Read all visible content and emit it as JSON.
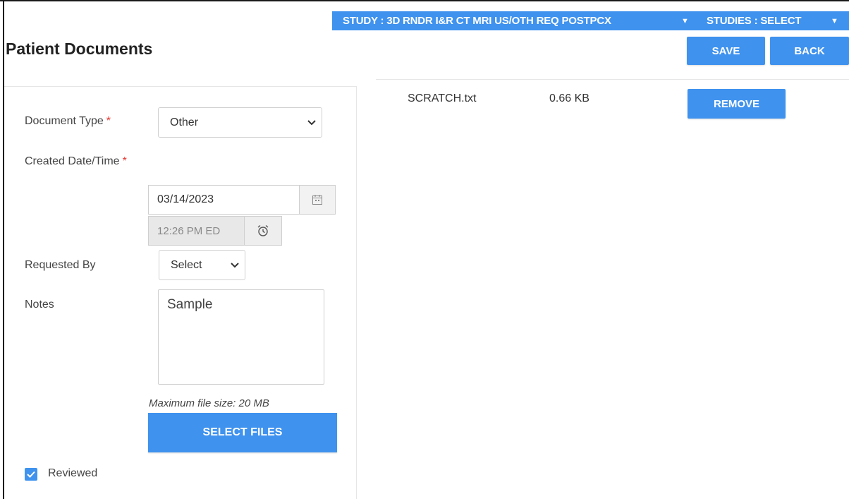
{
  "header": {
    "study_label": "STUDY : 3D RNDR I&R CT MRI US/OTH REQ POSTPCX",
    "studies_label": "STUDIES : SELECT",
    "page_title": "Patient Documents",
    "save_label": "SAVE",
    "back_label": "BACK"
  },
  "form": {
    "document_type_label": "Document Type",
    "document_type_value": "Other",
    "created_label": "Created Date/Time",
    "date_value": "03/14/2023",
    "time_value": "12:26 PM ED",
    "requested_by_label": "Requested By",
    "requested_by_value": "Select",
    "notes_label": "Notes",
    "notes_value": "Sample",
    "required_marker": "*",
    "max_size_hint": "Maximum file size: 20 MB",
    "select_files_label": "SELECT FILES",
    "reviewed_label": "Reviewed",
    "reviewed_checked": true
  },
  "files": [
    {
      "name": "SCRATCH.txt",
      "size": "0.66 KB",
      "action": "REMOVE"
    }
  ],
  "colors": {
    "accent": "#3f92ee",
    "required": "#e53935"
  },
  "icons": {
    "calendar": "calendar-icon",
    "clock": "alarm-clock-icon",
    "check": "check-icon",
    "dropdown": "chevron-down-icon"
  }
}
